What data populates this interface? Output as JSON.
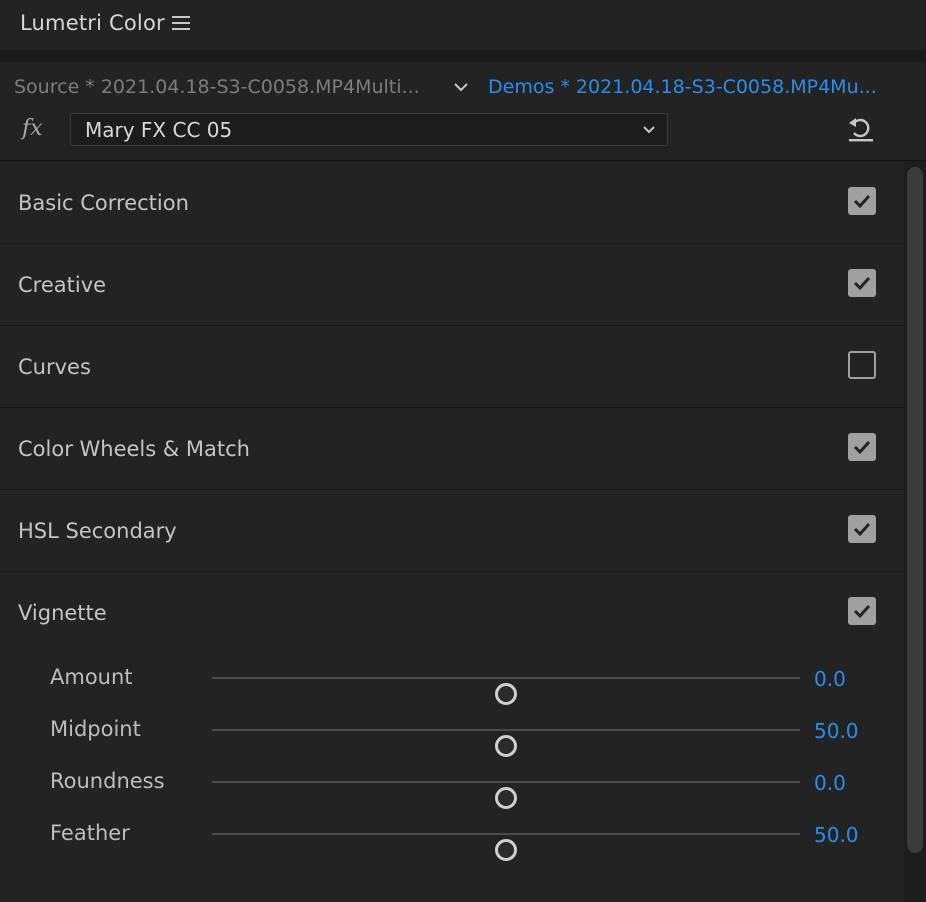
{
  "panel": {
    "title": "Lumetri Color",
    "menu_icon": "hamburger-menu-icon"
  },
  "header": {
    "source_tab": "Source * 2021.04.18-S3-C0058.MP4Multi...",
    "demos_tab": "Demos * 2021.04.18-S3-C0058.MP4Mu...",
    "fx_icon": "fx",
    "preset_value": "Mary FX CC 05",
    "reset_icon": "reset-icon"
  },
  "sections": [
    {
      "label": "Basic Correction",
      "checked": true
    },
    {
      "label": "Creative",
      "checked": true
    },
    {
      "label": "Curves",
      "checked": false
    },
    {
      "label": "Color Wheels & Match",
      "checked": true
    },
    {
      "label": "HSL Secondary",
      "checked": true
    },
    {
      "label": "Vignette",
      "checked": true
    }
  ],
  "vignette": {
    "sliders": [
      {
        "label": "Amount",
        "value": "0.0",
        "position": 0.5
      },
      {
        "label": "Midpoint",
        "value": "50.0",
        "position": 0.5
      },
      {
        "label": "Roundness",
        "value": "0.0",
        "position": 0.5
      },
      {
        "label": "Feather",
        "value": "50.0",
        "position": 0.5
      }
    ]
  },
  "colors": {
    "accent": "#2d8ceb",
    "background": "#232323"
  }
}
